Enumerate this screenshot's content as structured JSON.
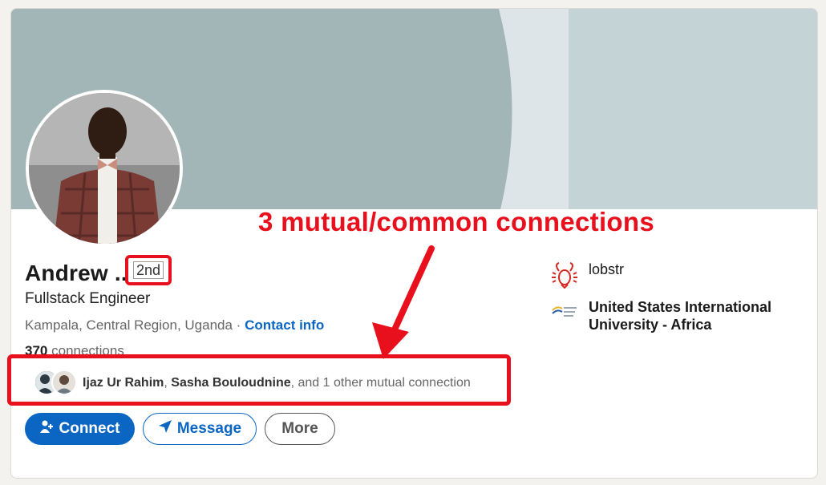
{
  "profile": {
    "name": "Andrew ...",
    "degree": "2nd",
    "headline": "Fullstack Engineer",
    "location": "Kampala, Central Region, Uganda",
    "separator": "·",
    "contact_info": "Contact info",
    "connections_count": "370",
    "connections_label": "connections"
  },
  "mutual": {
    "name1": "Ijaz Ur Rahim",
    "sep": ",",
    "name2": "Sasha Bouloudnine",
    "rest": ", and 1 other mutual connection"
  },
  "actions": {
    "connect": "Connect",
    "message": "Message",
    "more": "More"
  },
  "orgs": {
    "company": "lobstr",
    "school_line1": "United States International",
    "school_line2": "University - Africa"
  },
  "annotation": {
    "text": "3 mutual/common connections"
  },
  "colors": {
    "accent": "#0a66c2",
    "annotation_red": "#e8101c",
    "banner": "#c3d3d6"
  },
  "icons": {
    "connect": "person-add-icon",
    "message": "paper-plane-icon",
    "company": "lobster-logo-icon",
    "school": "usiu-logo-icon"
  }
}
